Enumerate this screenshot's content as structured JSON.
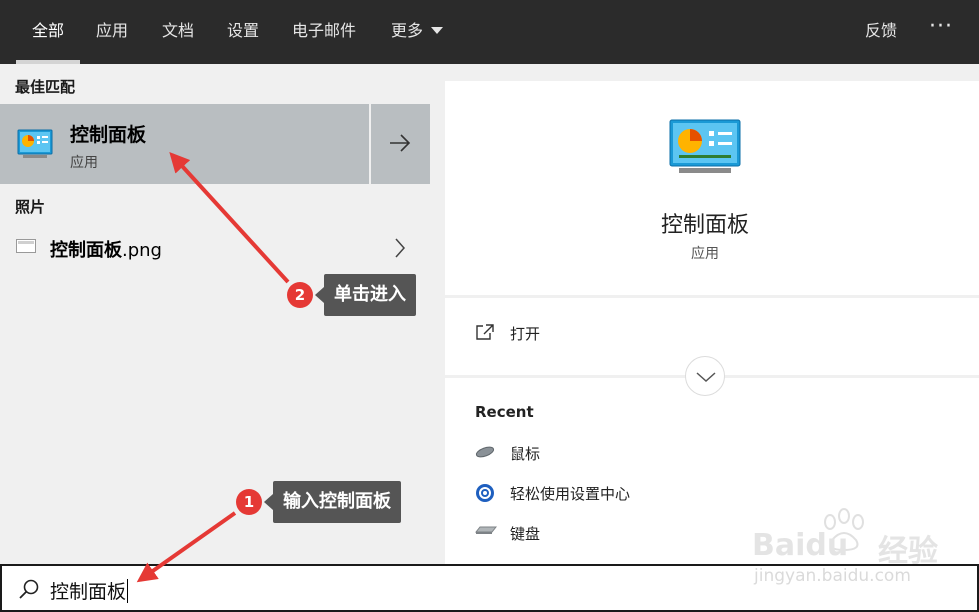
{
  "tabs": [
    {
      "label": "全部",
      "active": true
    },
    {
      "label": "应用"
    },
    {
      "label": "文档"
    },
    {
      "label": "设置"
    },
    {
      "label": "电子邮件"
    },
    {
      "label": "更多"
    }
  ],
  "feedback_label": "反馈",
  "more_options": "···",
  "best_match": {
    "heading": "最佳匹配",
    "title": "控制面板",
    "subtitle": "应用"
  },
  "photos": {
    "heading": "照片",
    "file_bold": "控制面板",
    "file_ext": ".png"
  },
  "preview": {
    "title": "控制面板",
    "subtitle": "应用",
    "open_label": "打开"
  },
  "recent": {
    "heading": "Recent",
    "items": [
      {
        "label": "鼠标",
        "icon": "mouse-icon"
      },
      {
        "label": "轻松使用设置中心",
        "icon": "ease-of-access-icon"
      },
      {
        "label": "键盘",
        "icon": "keyboard-icon"
      }
    ]
  },
  "search": {
    "value": "控制面板"
  },
  "annotations": [
    {
      "number": "1",
      "text": "输入控制面板"
    },
    {
      "number": "2",
      "text": "单击进入"
    }
  ],
  "watermark": {
    "logo": "Baidu",
    "word": "经验",
    "url": "jingyan.baidu.com"
  },
  "colors": {
    "accent_red": "#e53935",
    "selected_bg": "#b9bec1",
    "topbar_bg": "#2b2b2b",
    "callout_bg": "#555555"
  }
}
